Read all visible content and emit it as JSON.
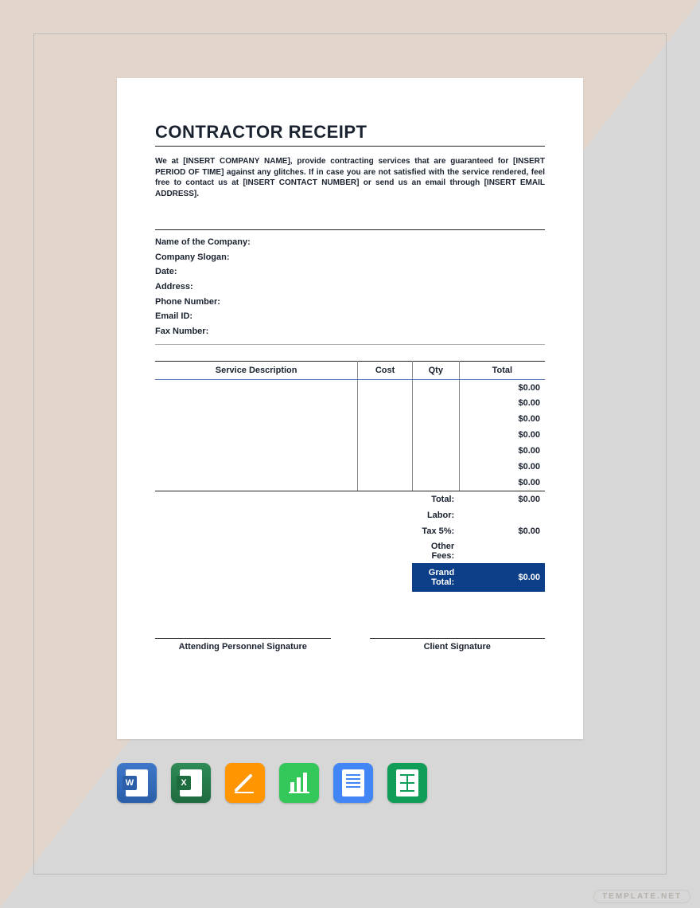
{
  "title": "CONTRACTOR RECEIPT",
  "intro": "We at [INSERT COMPANY NAME], provide contracting services that are guaranteed for [INSERT PERIOD OF TIME] against any glitches. If in case you are not satisfied with the service rendered, feel free to contact us at [INSERT CONTACT NUMBER] or send us an email through [INSERT EMAIL ADDRESS].",
  "info": {
    "companyName": "Name of the Company:",
    "slogan": "Company Slogan:",
    "date": "Date:",
    "address": "Address:",
    "phone": "Phone Number:",
    "email": "Email ID:",
    "fax": "Fax Number:"
  },
  "table": {
    "headers": {
      "desc": "Service Description",
      "cost": "Cost",
      "qty": "Qty",
      "total": "Total"
    },
    "rows": [
      {
        "desc": "",
        "cost": "",
        "qty": "",
        "total": "$0.00"
      },
      {
        "desc": "",
        "cost": "",
        "qty": "",
        "total": "$0.00"
      },
      {
        "desc": "",
        "cost": "",
        "qty": "",
        "total": "$0.00"
      },
      {
        "desc": "",
        "cost": "",
        "qty": "",
        "total": "$0.00"
      },
      {
        "desc": "",
        "cost": "",
        "qty": "",
        "total": "$0.00"
      },
      {
        "desc": "",
        "cost": "",
        "qty": "",
        "total": "$0.00"
      },
      {
        "desc": "",
        "cost": "",
        "qty": "",
        "total": "$0.00"
      }
    ]
  },
  "summary": {
    "totalLabel": "Total:",
    "totalVal": "$0.00",
    "laborLabel": "Labor:",
    "laborVal": "",
    "taxLabel": "Tax 5%:",
    "taxVal": "$0.00",
    "otherLabel": "Other Fees:",
    "otherVal": "",
    "grandLabel": "Grand Total:",
    "grandVal": "$0.00"
  },
  "signatures": {
    "personnel": "Attending Personnel Signature",
    "client": "Client Signature"
  },
  "watermark": "TEMPLATE.NET"
}
